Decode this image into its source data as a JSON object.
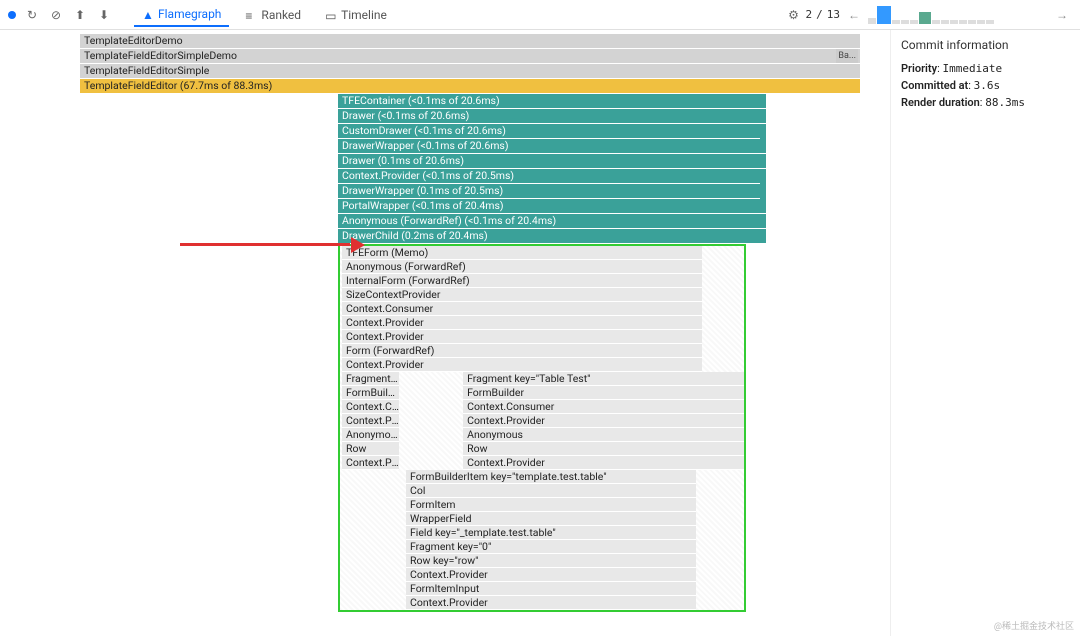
{
  "toolbar": {
    "tabs": {
      "flamegraph": "Flamegraph",
      "ranked": "Ranked",
      "timeline": "Timeline"
    },
    "counter_current": "2",
    "counter_sep": "/",
    "counter_total": "13",
    "nav_left": "←",
    "nav_right": "→"
  },
  "sidebar": {
    "title": "Commit information",
    "priority_label": "Priority",
    "priority_value": "Immediate",
    "committed_label": "Committed at",
    "committed_value": "3.6s",
    "render_label": "Render duration",
    "render_value": "88.3ms"
  },
  "flame": {
    "r1": "TemplateEditorDemo",
    "r2": "TemplateFieldEditorSimpleDemo",
    "r2_badge": "Ba...",
    "r3": "TemplateFieldEditorSimple",
    "r4": "TemplateFieldEditor (67.7ms of 88.3ms)",
    "t1": "TFEContainer (<0.1ms of 20.6ms)",
    "t2": "Drawer (<0.1ms of 20.6ms)",
    "t3": "CustomDrawer (<0.1ms of 20.6ms)",
    "t4": "DrawerWrapper (<0.1ms of 20.6ms)",
    "t5": "Drawer (0.1ms of 20.6ms)",
    "t6": "Context.Provider (<0.1ms of 20.5ms)",
    "t7": "DrawerWrapper (0.1ms of 20.5ms)",
    "t8": "PortalWrapper (<0.1ms of 20.4ms)",
    "t9": "Anonymous (ForwardRef) (<0.1ms of 20.4ms)",
    "t10": "DrawerChild (0.2ms of 20.4ms)",
    "g1": "TFEForm (Memo)",
    "g2": "Anonymous (ForwardRef)",
    "g3": "InternalForm (ForwardRef)",
    "g4": "SizeContextProvider",
    "g5": "Context.Consumer",
    "g6": "Context.Provider",
    "g7": "Context.Provider",
    "g8": "Form (ForwardRef)",
    "g9": "Context.Provider",
    "s1a": "Fragment k...",
    "s1b": "Fragment key=\"Table Test\"",
    "s2a": "FormBuilder",
    "s2b": "FormBuilder",
    "s3a": "Context.Co...",
    "s3b": "Context.Consumer",
    "s4a": "Context.Pr...",
    "s4b": "Context.Provider",
    "s5a": "Anonymous",
    "s5b": "Anonymous",
    "s6a": "Row",
    "s6b": "Row",
    "s7a": "Context.Pr...",
    "s7b": "Context.Provider",
    "d1": "FormBuilderItem key=\"template.test.table\"",
    "d2": "Col",
    "d3": "FormItem",
    "d4": "WrapperField",
    "d5": "Field key=\"_template.test.table\"",
    "d6": "Fragment key=\"0\"",
    "d7": "Row key=\"row\"",
    "d8": "Context.Provider",
    "d9": "FormItemInput",
    "d10": "Context.Provider"
  },
  "watermark": "@稀土掘金技术社区"
}
